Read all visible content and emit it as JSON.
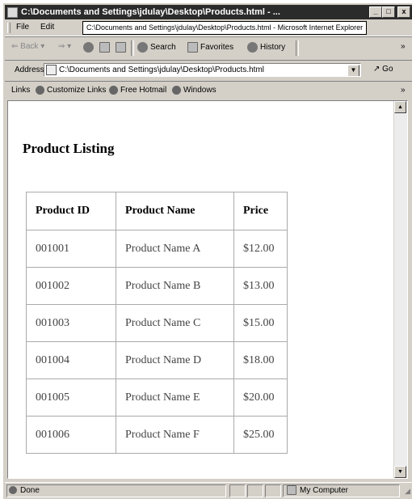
{
  "window": {
    "title": "C:\\Documents and Settings\\jdulay\\Desktop\\Products.html - ...",
    "min": "_",
    "max": "□",
    "close": "x"
  },
  "menu": {
    "file": "File",
    "edit": "Edit",
    "tooltip": "C:\\Documents and Settings\\jdulay\\Desktop\\Products.html - Microsoft Internet Explorer"
  },
  "toolbar": {
    "back": "Back",
    "search": "Search",
    "favorites": "Favorites",
    "history": "History",
    "chevron": "»"
  },
  "address": {
    "label": "Address",
    "value": "C:\\Documents and Settings\\jdulay\\Desktop\\Products.html",
    "go": "Go"
  },
  "links": {
    "label": "Links",
    "items": [
      "Customize Links",
      "Free Hotmail",
      "Windows"
    ],
    "chevron": "»"
  },
  "page": {
    "title": "Product Listing",
    "table": {
      "headers": [
        "Product ID",
        "Product Name",
        "Price"
      ],
      "rows": [
        [
          "001001",
          "Product Name A",
          "$12.00"
        ],
        [
          "001002",
          "Product Name B",
          "$13.00"
        ],
        [
          "001003",
          "Product Name C",
          "$15.00"
        ],
        [
          "001004",
          "Product Name D",
          "$18.00"
        ],
        [
          "001005",
          "Product Name E",
          "$20.00"
        ],
        [
          "001006",
          "Product Name F",
          "$25.00"
        ]
      ]
    }
  },
  "status": {
    "text": "Done",
    "zone": "My Computer"
  }
}
